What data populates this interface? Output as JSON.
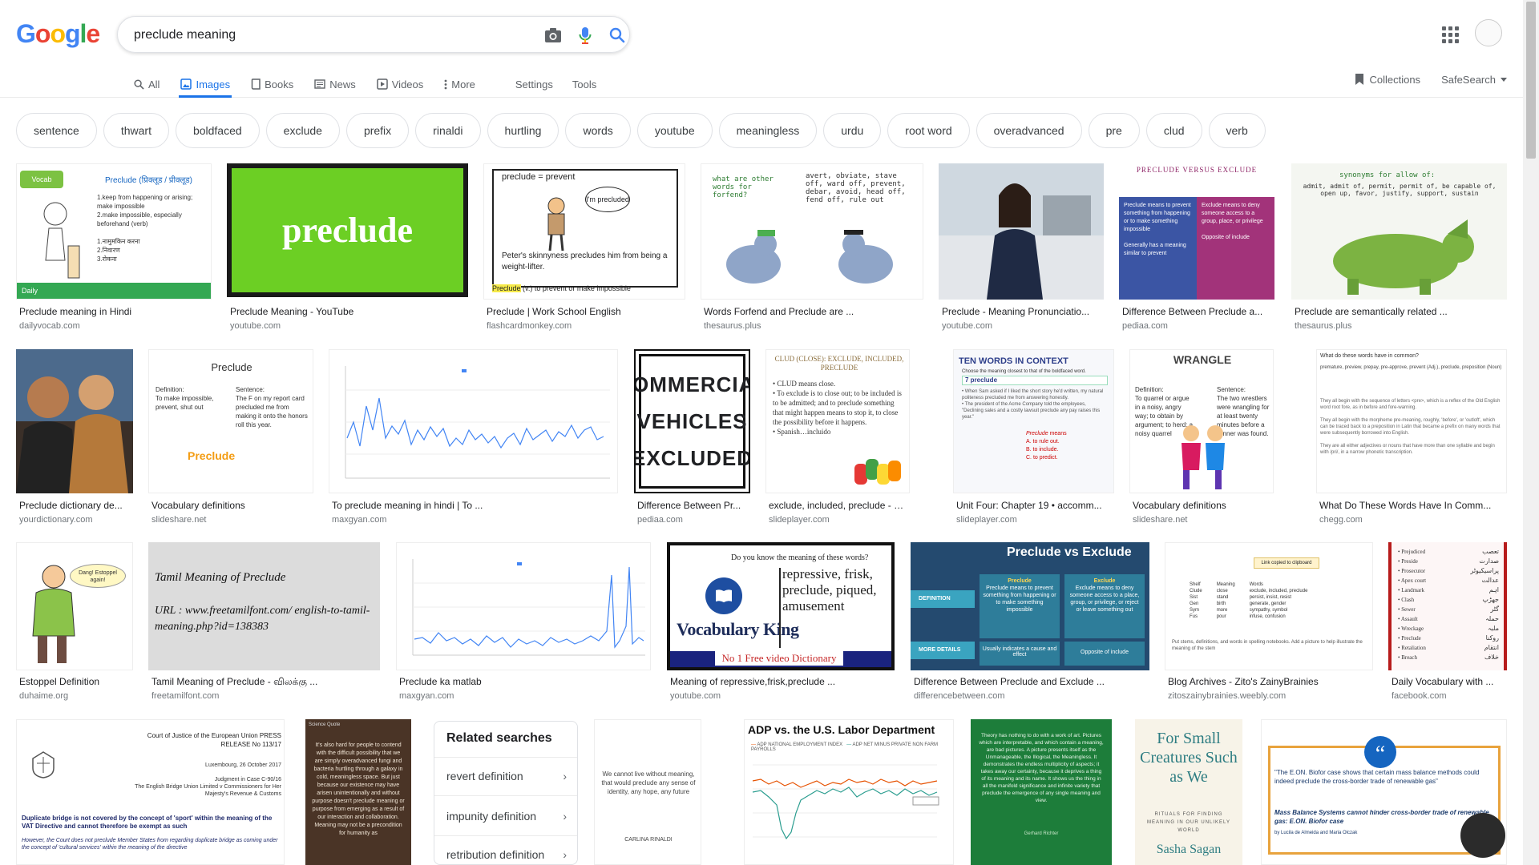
{
  "logo": [
    "G",
    "o",
    "o",
    "g",
    "l",
    "e"
  ],
  "search": {
    "value": "preclude meaning"
  },
  "tabs": [
    {
      "label": "All",
      "icon": "search-icon"
    },
    {
      "label": "Images",
      "icon": "image-icon",
      "active": true
    },
    {
      "label": "Books",
      "icon": "book-icon"
    },
    {
      "label": "News",
      "icon": "news-icon"
    },
    {
      "label": "Videos",
      "icon": "video-icon"
    },
    {
      "label": "More",
      "icon": "more-vert-icon"
    }
  ],
  "tools": {
    "settings": "Settings",
    "tools": "Tools",
    "collections": "Collections",
    "safesearch": "SafeSearch"
  },
  "chips": [
    "sentence",
    "thwart",
    "boldfaced",
    "exclude",
    "prefix",
    "rinaldi",
    "hurtling",
    "words",
    "youtube",
    "meaningless",
    "urdu",
    "root word",
    "overadvanced",
    "pre",
    "clud",
    "verb"
  ],
  "results_row1": [
    {
      "title": "Preclude meaning in Hindi",
      "source": "dailyvocab.com",
      "img_text": "Preclude (प्रिक्लूड / प्रीक्लूड)"
    },
    {
      "title": "Preclude Meaning - YouTube",
      "source": "youtube.com",
      "img_text": "preclude"
    },
    {
      "title": "Preclude | Work School English",
      "source": "flashcardmonkey.com",
      "img_text": "preclude = prevent"
    },
    {
      "title": "Words Forfend and Preclude are ...",
      "source": "thesaurus.plus",
      "img_text": "what are other words for forfend?"
    },
    {
      "title": "Preclude - Meaning Pronunciatio...",
      "source": "youtube.com",
      "img_text": ""
    },
    {
      "title": "Difference Between Preclude a...",
      "source": "pediaa.com",
      "img_text": "PRECLUDE VERSUS EXCLUDE"
    },
    {
      "title": "Preclude are semantically related ...",
      "source": "thesaurus.plus",
      "img_text": "synonyms for allow of:"
    }
  ],
  "results_row2": [
    {
      "title": "Preclude dictionary de...",
      "source": "yourdictionary.com",
      "img_text": ""
    },
    {
      "title": "Vocabulary definitions",
      "source": "slideshare.net",
      "img_text": "Preclude"
    },
    {
      "title": "To preclude meaning in hindi | To ...",
      "source": "maxgyan.com",
      "img_text": ""
    },
    {
      "title": "Difference Between Pr...",
      "source": "pediaa.com",
      "img_text": "COMMERCIAL VEHICLES EXCLUDED"
    },
    {
      "title": "exclude, included, preclude - ppt vi...",
      "source": "slideplayer.com",
      "img_text": "CLUD (CLOSE): EXCLUDE, INCLUDED, PRECLUDE"
    },
    {
      "title": "Unit Four: Chapter 19 • accomm...",
      "source": "slideplayer.com",
      "img_text": "TEN WORDS IN CONTEXT"
    },
    {
      "title": "Vocabulary definitions",
      "source": "slideshare.net",
      "img_text": "WRANGLE"
    },
    {
      "title": "What Do These Words Have In Comm...",
      "source": "chegg.com",
      "img_text": "What do these words have in common?"
    }
  ],
  "results_row3": [
    {
      "title": "Estoppel Definition",
      "source": "duhaime.org",
      "img_text": "Dang! Estoppel again!"
    },
    {
      "title": "Tamil Meaning of Preclude - விலக்கு ...",
      "source": "freetamilfont.com",
      "img_text": "Tamil Meaning of Preclude"
    },
    {
      "title": "Preclude ka matlab",
      "source": "maxgyan.com",
      "img_text": ""
    },
    {
      "title": "Meaning of repressive,frisk,preclude ...",
      "source": "youtube.com",
      "img_text": "Vocabulary King"
    },
    {
      "title": "Difference Between Preclude and Exclude ...",
      "source": "differencebetween.com",
      "img_text": "Preclude vs Exclude"
    },
    {
      "title": "Blog Archives - Zito's ZainyBrainies",
      "source": "zitoszainybrainies.weebly.com",
      "img_text": ""
    },
    {
      "title": "Daily Vocabulary with ...",
      "source": "facebook.com",
      "img_text": ""
    }
  ],
  "row3_extra_text": {
    "tamil_url": "URL : www.freetamilfont.com/ english-to-tamil-meaning.php?id=138383",
    "vk_question": "Do you know the meaning of these words?",
    "vk_words": "repressive, frisk, preclude, piqued, amusement",
    "vk_banner": "No 1 Free video Dictionary"
  },
  "results_row4": [
    {
      "img_text": "Court of Justice of the European Union PRESS RELEASE No 113/17"
    },
    {
      "img_text": "Science Quote"
    },
    {
      "img_text": "We cannot live without meaning, that would preclude any sense of identity, any hope, any future"
    },
    {
      "img_text": "ADP vs. the U.S. Labor Department"
    },
    {
      "img_text": ""
    },
    {
      "img_text": "For Small Creatures Such as We"
    },
    {
      "img_text": "\"The E.ON. Biofor case shows that certain mass balance methods could indeed preclude the cross-border trade of renewable gas\""
    }
  ],
  "row4_extra_text": {
    "rinaldi_author": "CARLINA RINALDI",
    "sagan_author": "Sasha Sagan",
    "sagan_sub": "RITUALS FOR FINDING MEANING IN OUR UNLIKELY WORLD"
  },
  "related": {
    "title": "Related searches",
    "items": [
      "revert definition",
      "impunity definition",
      "retribution definition"
    ]
  },
  "colors": {
    "accent": "#1a73e8",
    "chip_border": "#dfe1e5",
    "muted": "#70757a"
  }
}
